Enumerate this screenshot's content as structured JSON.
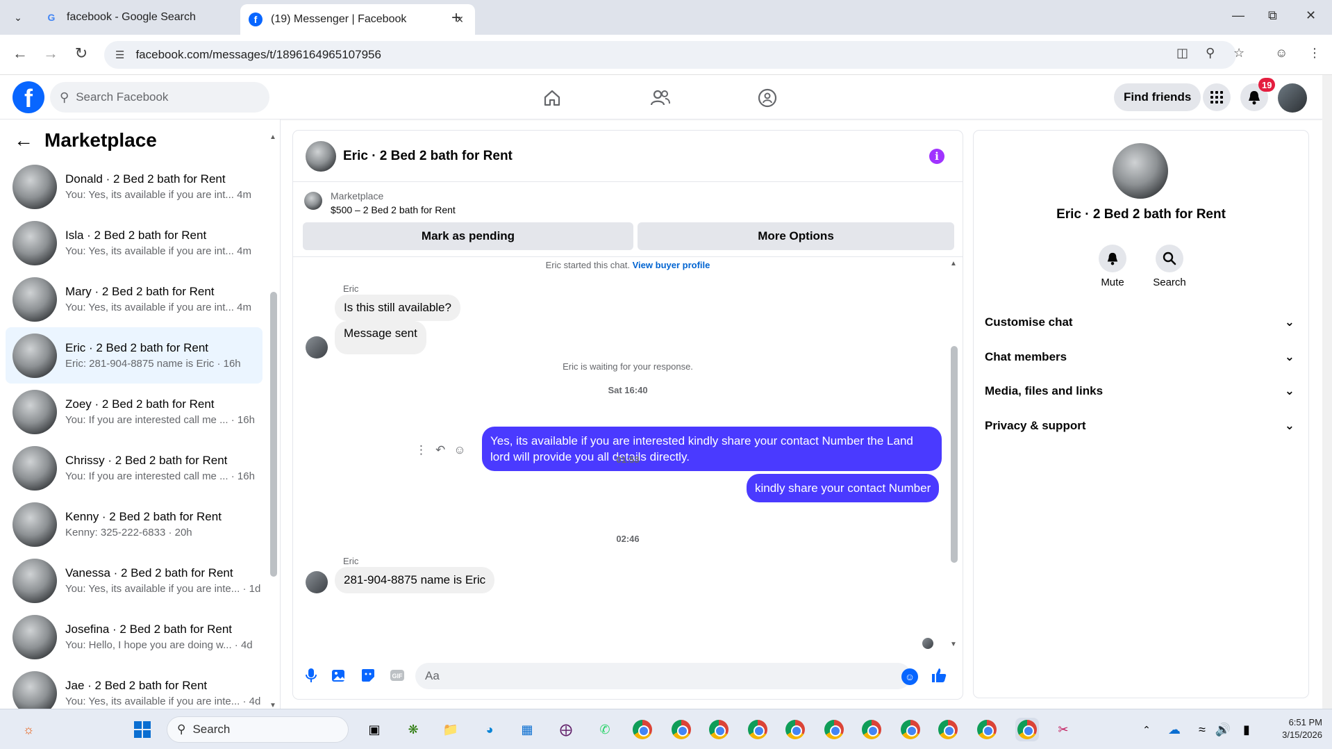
{
  "browser": {
    "tabs": [
      {
        "title": "facebook - Google Search",
        "favicon": "google-icon"
      },
      {
        "title": "(19) Messenger | Facebook",
        "favicon": "facebook-icon"
      }
    ],
    "url": "facebook.com/messages/t/1896164965107956"
  },
  "fb_header": {
    "search_placeholder": "Search Facebook",
    "find_friends": "Find friends",
    "notifications_count": "19"
  },
  "left_panel": {
    "title": "Marketplace",
    "conversations": [
      {
        "name": "Donald · 2 Bed 2 bath for Rent",
        "snippet": "You: Yes, its available if you are int...  4m"
      },
      {
        "name": "Isla · 2 Bed 2 bath for Rent",
        "snippet": "You: Yes, its available if you are int...  4m"
      },
      {
        "name": "Mary · 2 Bed 2 bath for Rent",
        "snippet": "You: Yes, its available if you are int...  4m"
      },
      {
        "name": "Eric · 2 Bed 2 bath for Rent",
        "snippet": "Eric: 281-904-8875 name is Eric · 16h"
      },
      {
        "name": "Zoey · 2 Bed 2 bath for Rent",
        "snippet": "You: If you are interested call me ... · 16h"
      },
      {
        "name": "Chrissy · 2 Bed 2 bath for Rent",
        "snippet": "You: If you are interested call me ... · 16h"
      },
      {
        "name": "Kenny · 2 Bed 2 bath for Rent",
        "snippet": "Kenny: 325-222-6833 · 20h"
      },
      {
        "name": "Vanessa · 2 Bed 2 bath for Rent",
        "snippet": "You: Yes, its available if you are inte... · 1d"
      },
      {
        "name": "Josefina · 2 Bed 2 bath for Rent",
        "snippet": "You: Hello, I hope you are doing w... · 4d"
      },
      {
        "name": "Jae · 2 Bed 2 bath for Rent",
        "snippet": "You: Yes, its available if you are inte... · 4d"
      }
    ]
  },
  "chat": {
    "title": "Eric · 2 Bed 2 bath for Rent",
    "marketplace_label": "Marketplace",
    "listing": "$500 – 2 Bed 2 bath for Rent",
    "mark_pending": "Mark as pending",
    "more_options": "More Options",
    "started": "Eric started this chat.",
    "view_buyer": "View buyer profile",
    "sender_name": "Eric",
    "msg1": "Is this still available?",
    "msg2": "Message sent",
    "waiting": "Eric is waiting for your response.",
    "time1": "Sat 16:40",
    "out1": "Yes, its available if you are interested kindly share your contact Number the Land lord will provide you all details directly.",
    "time2": "01:53",
    "out2": "kindly share your contact Number",
    "time3": "02:46",
    "msg3": "281-904-8875 name is Eric",
    "composer_placeholder": "Aa"
  },
  "right_panel": {
    "name": "Eric · 2 Bed 2 bath for Rent",
    "mute": "Mute",
    "search": "Search",
    "sections": [
      "Customise chat",
      "Chat members",
      "Media, files and links",
      "Privacy & support"
    ]
  },
  "taskbar": {
    "search": "Search",
    "time": "6:51 PM",
    "date": "3/15/2026"
  },
  "colors": {
    "fb_blue": "#0866ff",
    "outgoing_bubble": "#4a3aff",
    "selected_row": "#ebf5ff"
  }
}
